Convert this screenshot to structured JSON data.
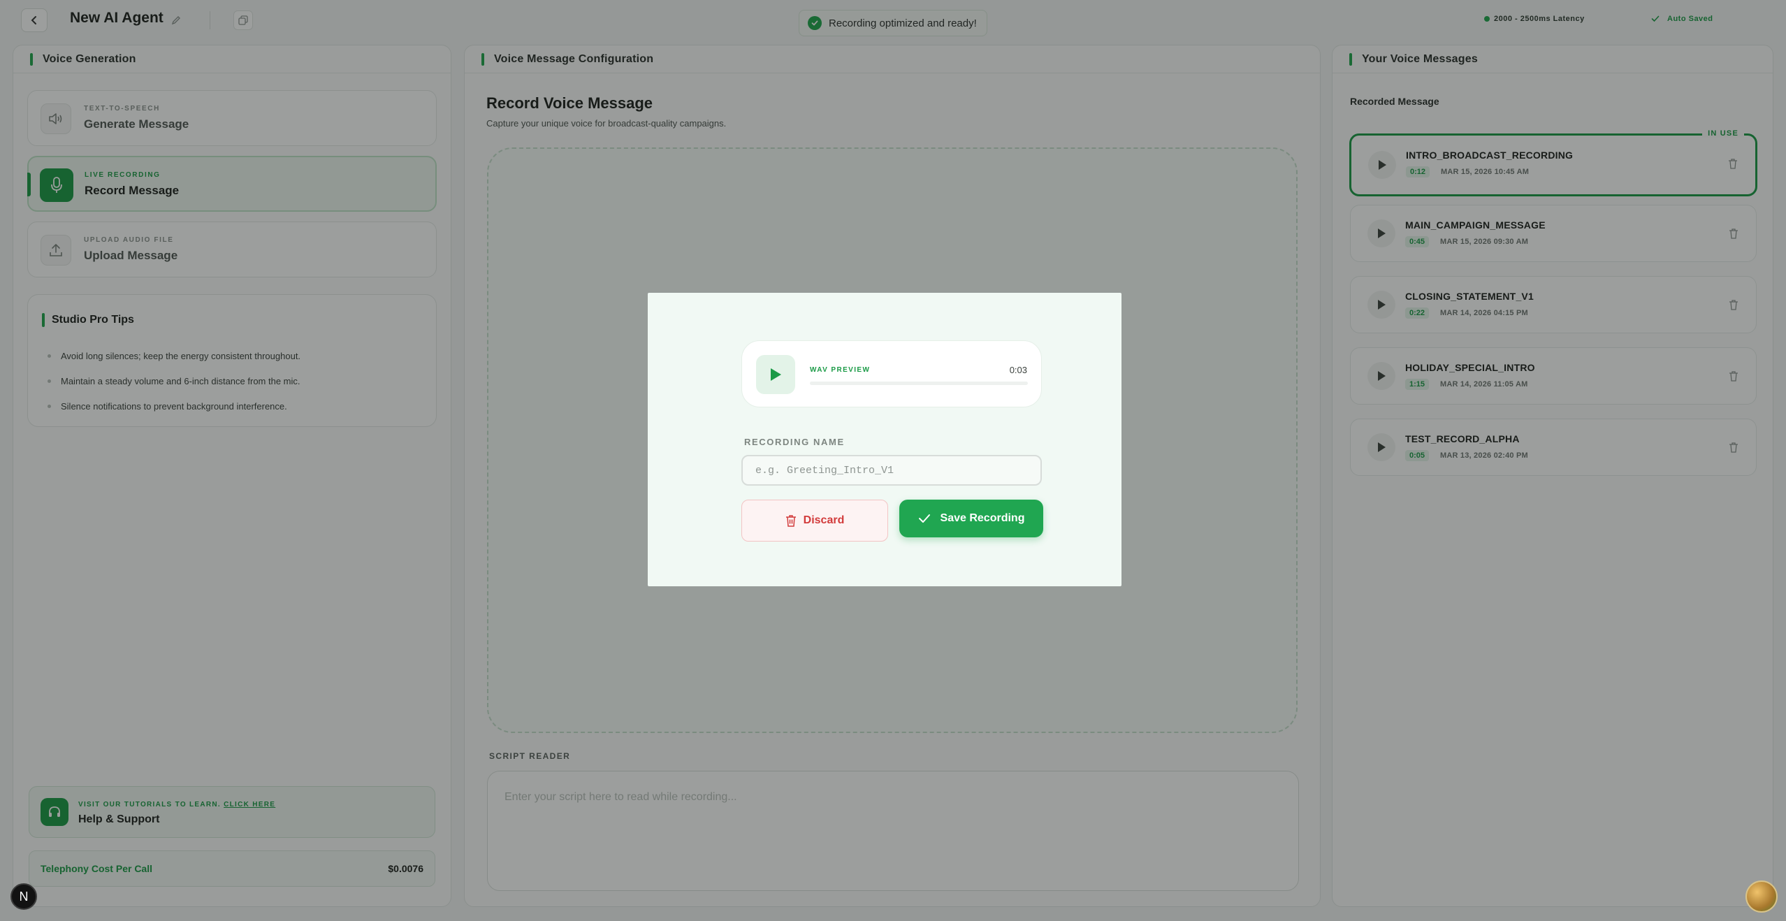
{
  "header": {
    "agent_title": "New AI Agent",
    "toast": "Recording optimized and ready!",
    "latency": "2000 - 2500ms Latency",
    "autosaved": "Auto Saved"
  },
  "left_panel": {
    "title": "Voice Generation",
    "options": [
      {
        "kicker": "TEXT-TO-SPEECH",
        "title": "Generate Message",
        "icon": "speaker-icon",
        "active": false
      },
      {
        "kicker": "LIVE RECORDING",
        "title": "Record Message",
        "icon": "microphone-icon",
        "active": true
      },
      {
        "kicker": "UPLOAD AUDIO FILE",
        "title": "Upload Message",
        "icon": "upload-icon",
        "active": false
      }
    ],
    "tips": {
      "title": "Studio Pro Tips",
      "items": [
        "Avoid long silences; keep the energy consistent throughout.",
        "Maintain a steady volume and 6-inch distance from the mic.",
        "Silence notifications to prevent background interference."
      ]
    },
    "help": {
      "kicker_prefix": "VISIT OUR TUTORIALS TO LEARN.",
      "kicker_link": "CLICK HERE",
      "title": "Help & Support"
    },
    "cost": {
      "label": "Telephony Cost Per Call",
      "value": "$0.0076"
    }
  },
  "center_panel": {
    "title": "Voice Message Configuration",
    "heading": "Record Voice Message",
    "subheading": "Capture your unique voice for broadcast-quality campaigns.",
    "script_label": "SCRIPT READER",
    "script_placeholder": "Enter your script here to read while recording..."
  },
  "right_panel": {
    "title": "Your Voice Messages",
    "section_label": "Recorded Message",
    "in_use_label": "IN USE",
    "messages": [
      {
        "name": "INTRO_BROADCAST_RECORDING",
        "duration": "0:12",
        "date": "MAR 15, 2026 10:45 AM",
        "in_use": true
      },
      {
        "name": "MAIN_CAMPAIGN_MESSAGE",
        "duration": "0:45",
        "date": "MAR 15, 2026 09:30 AM",
        "in_use": false
      },
      {
        "name": "CLOSING_STATEMENT_V1",
        "duration": "0:22",
        "date": "MAR 14, 2026 04:15 PM",
        "in_use": false
      },
      {
        "name": "HOLIDAY_SPECIAL_INTRO",
        "duration": "1:15",
        "date": "MAR 14, 2026 11:05 AM",
        "in_use": false
      },
      {
        "name": "TEST_RECORD_ALPHA",
        "duration": "0:05",
        "date": "MAR 13, 2026 02:40 PM",
        "in_use": false
      }
    ]
  },
  "modal": {
    "preview_label": "WAV PREVIEW",
    "preview_time": "0:03",
    "preview_progress": 0,
    "name_label": "RECORDING NAME",
    "name_placeholder": "e.g. Greeting_Intro_V1",
    "name_value": "",
    "discard_label": "Discard",
    "save_label": "Save Recording"
  },
  "badge_letter": "N",
  "colors": {
    "accent": "#1a9a46",
    "danger": "#d23b3b"
  }
}
